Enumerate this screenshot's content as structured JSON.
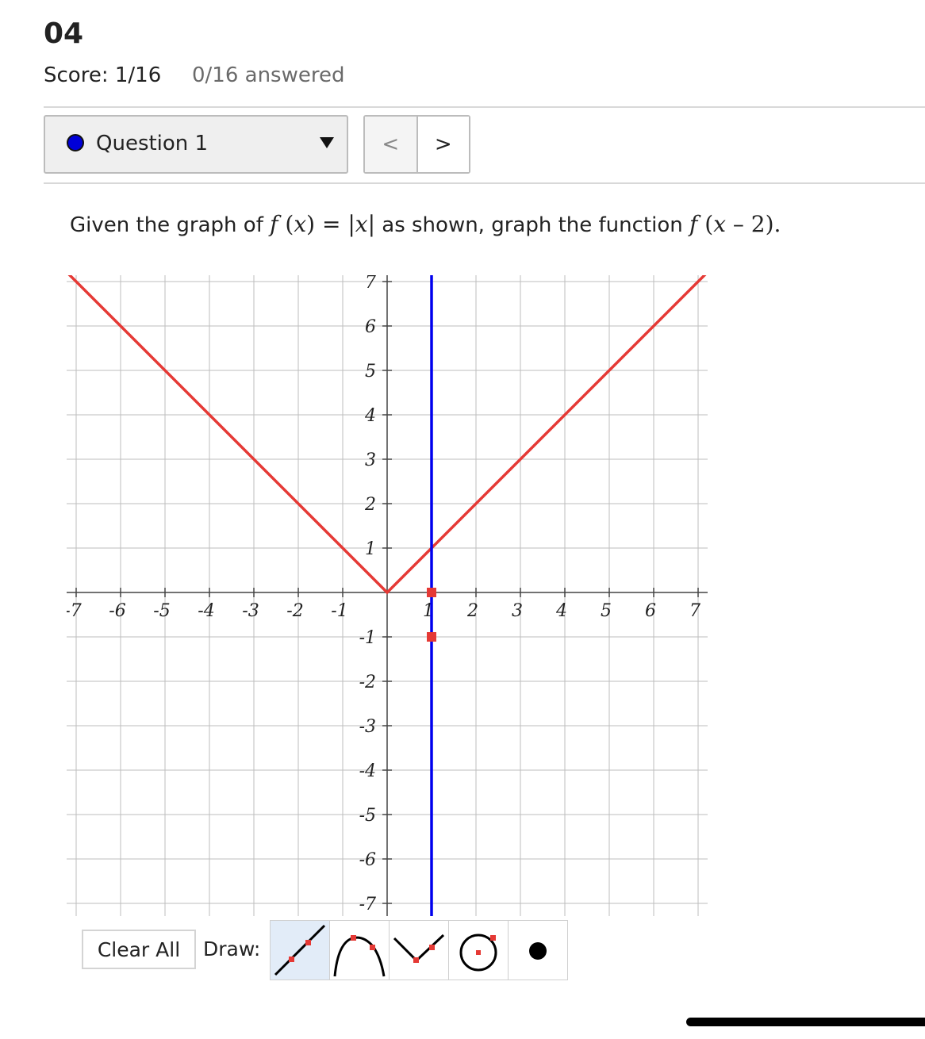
{
  "header": {
    "title": "04",
    "score": "Score: 1/16",
    "answered": "0/16 answered"
  },
  "question_nav": {
    "selected": "Question 1",
    "prev_label": "<",
    "next_label": ">"
  },
  "question": {
    "text_before": "Given the graph of ",
    "f1": "f",
    "lp1": " (",
    "x1": "x",
    "rp1": ") = |",
    "x2": "x",
    "abs_end": "|",
    "text_middle": " as shown, graph the function ",
    "f2": "f",
    "lp2": " (",
    "x3": "x",
    "minus": " – 2",
    "text_end": ")."
  },
  "graph": {
    "x_range": [
      -7,
      7
    ],
    "y_range": [
      -7,
      7
    ],
    "x_ticks": [
      "-7",
      "-6",
      "-5",
      "-4",
      "-3",
      "-2",
      "-1",
      "1",
      "2",
      "3",
      "4",
      "5",
      "6",
      "7"
    ],
    "y_ticks": [
      "7",
      "6",
      "5",
      "4",
      "3",
      "2",
      "1",
      "-1",
      "-2",
      "-3",
      "-4",
      "-5",
      "-6",
      "-7"
    ],
    "given_function": {
      "color": "#e53935",
      "vertex": [
        0,
        0
      ],
      "slopes": [
        -1,
        1
      ]
    },
    "vertical_line": {
      "color": "#0000ee",
      "x": 1
    },
    "points": [
      {
        "x": 1,
        "y": 0,
        "color": "#e53935"
      },
      {
        "x": 1,
        "y": -1,
        "color": "#e53935"
      }
    ]
  },
  "toolbar": {
    "clear_label": "Clear All",
    "draw_label": "Draw:",
    "tools": [
      "line-tool-icon",
      "parabola-tool-icon",
      "absolute-value-tool-icon",
      "circle-tool-icon",
      "point-tool-icon"
    ],
    "active_tool": "line-tool-icon"
  }
}
